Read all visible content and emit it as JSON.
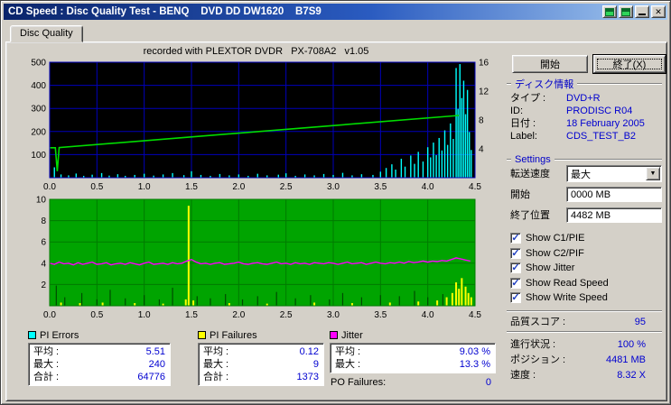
{
  "window": {
    "title": "CD Speed : Disc Quality Test - BENQ    DVD DD DW1620    B7S9"
  },
  "icons": {
    "minimize": "",
    "close": "✕",
    "combo_arrow": "▼",
    "check": "✓"
  },
  "tab": {
    "label": "Disc Quality"
  },
  "chart_header": "recorded with PLEXTOR DVDR   PX-708A2   v1.05",
  "buttons": {
    "start": "開始",
    "exit": "終了(X)"
  },
  "disc_info": {
    "title": "ディスク情報",
    "rows": [
      {
        "label": "タイプ :",
        "value": "DVD+R"
      },
      {
        "label": "ID:",
        "value": "PRODISC R04"
      },
      {
        "label": "日付 :",
        "value": "18 February 2005"
      },
      {
        "label": "Label:",
        "value": "CDS_TEST_B2"
      }
    ]
  },
  "settings": {
    "title": "Settings",
    "speed_label": "転送速度",
    "speed_value": "最大",
    "start_label": "開始",
    "start_value": "0000 MB",
    "end_label": "終了位置",
    "end_value": "4482 MB",
    "checkboxes": [
      {
        "label": "Show C1/PIE",
        "checked": true
      },
      {
        "label": "Show C2/PIF",
        "checked": true
      },
      {
        "label": "Show Jitter",
        "checked": true
      },
      {
        "label": "Show Read Speed",
        "checked": true
      },
      {
        "label": "Show Write Speed",
        "checked": true
      }
    ]
  },
  "quality": {
    "label": "品質スコア :",
    "value": "95"
  },
  "progress": [
    {
      "label": "進行状況 :",
      "value": "100 %"
    },
    {
      "label": "ポジション :",
      "value": "4481 MB"
    },
    {
      "label": "速度 :",
      "value": "8.32 X"
    }
  ],
  "legends": [
    {
      "name": "PI Errors",
      "color": "#00FFFF",
      "rows": [
        [
          "平均 :",
          "5.51"
        ],
        [
          "最大 :",
          "240"
        ],
        [
          "合計 :",
          "64776"
        ]
      ]
    },
    {
      "name": "PI Failures",
      "color": "#FFFF00",
      "rows": [
        [
          "平均 :",
          "0.12"
        ],
        [
          "最大 :",
          "9"
        ],
        [
          "合計 :",
          "1373"
        ]
      ]
    },
    {
      "name": "Jitter",
      "color": "#FF00FF",
      "rows": [
        [
          "平均 :",
          "9.03 %"
        ],
        [
          "最大 :",
          "13.3 %"
        ]
      ],
      "extra": {
        "label": "PO Failures:",
        "value": "0"
      }
    }
  ],
  "chart_data": [
    {
      "type": "line",
      "title": "PI Errors / Speed",
      "bg": "#000000",
      "grid": "#0000BB",
      "x": {
        "min": 0,
        "max": 4.5,
        "ticks": [
          0,
          0.5,
          1,
          1.5,
          2,
          2.5,
          3,
          3.5,
          4,
          4.5
        ],
        "labels": [
          "0.0",
          "0.5",
          "1.0",
          "1.5",
          "2.0",
          "2.5",
          "3.0",
          "3.5",
          "4.0",
          "4.5"
        ]
      },
      "y_left": {
        "min": 0,
        "max": 500,
        "ticks": [
          100,
          200,
          300,
          400,
          500
        ]
      },
      "y_right": {
        "min": 0,
        "max": 16,
        "ticks": [
          4,
          8,
          12,
          16
        ]
      },
      "series": [
        {
          "name": "PI Errors",
          "type": "spikes",
          "axis": "left",
          "color": "#00FFFF",
          "w": 1.4,
          "points": [
            [
              0.05,
              45
            ],
            [
              0.12,
              14
            ],
            [
              0.2,
              10
            ],
            [
              0.28,
              18
            ],
            [
              0.36,
              8
            ],
            [
              0.45,
              13
            ],
            [
              0.55,
              20
            ],
            [
              0.63,
              9
            ],
            [
              0.72,
              15
            ],
            [
              0.8,
              8
            ],
            [
              0.9,
              12
            ],
            [
              1.0,
              17
            ],
            [
              1.1,
              9
            ],
            [
              1.2,
              14
            ],
            [
              1.3,
              20
            ],
            [
              1.42,
              11
            ],
            [
              1.5,
              28
            ],
            [
              1.6,
              12
            ],
            [
              1.7,
              8
            ],
            [
              1.8,
              16
            ],
            [
              1.9,
              10
            ],
            [
              2.0,
              14
            ],
            [
              2.1,
              8
            ],
            [
              2.2,
              17
            ],
            [
              2.3,
              10
            ],
            [
              2.42,
              13
            ],
            [
              2.5,
              19
            ],
            [
              2.6,
              8
            ],
            [
              2.7,
              14
            ],
            [
              2.8,
              10
            ],
            [
              2.9,
              16
            ],
            [
              3.0,
              12
            ],
            [
              3.1,
              21
            ],
            [
              3.2,
              10
            ],
            [
              3.3,
              15
            ],
            [
              3.42,
              12
            ],
            [
              3.5,
              26
            ],
            [
              3.56,
              42
            ],
            [
              3.62,
              58
            ],
            [
              3.66,
              35
            ],
            [
              3.72,
              82
            ],
            [
              3.76,
              48
            ],
            [
              3.82,
              96
            ],
            [
              3.86,
              60
            ],
            [
              3.9,
              112
            ],
            [
              3.95,
              70
            ],
            [
              4.0,
              132
            ],
            [
              4.03,
              88
            ],
            [
              4.06,
              152
            ],
            [
              4.09,
              98
            ],
            [
              4.12,
              172
            ],
            [
              4.15,
              118
            ],
            [
              4.18,
              205
            ],
            [
              4.21,
              142
            ],
            [
              4.24,
              235
            ],
            [
              4.27,
              168
            ],
            [
              4.3,
              475
            ],
            [
              4.32,
              298
            ],
            [
              4.34,
              492
            ],
            [
              4.36,
              345
            ],
            [
              4.38,
              420
            ],
            [
              4.4,
              275
            ],
            [
              4.42,
              380
            ],
            [
              4.44,
              198
            ],
            [
              4.46,
              120
            ]
          ]
        },
        {
          "name": "Write Speed",
          "type": "line",
          "axis": "right",
          "color": "#00DD00",
          "w": 1.6,
          "points": [
            [
              0,
              4.15
            ],
            [
              0.06,
              4.15
            ],
            [
              0.08,
              0.9
            ],
            [
              0.1,
              4.18
            ],
            [
              4.33,
              8.62
            ]
          ]
        }
      ]
    },
    {
      "type": "line",
      "title": "PI Failures / Jitter",
      "bg": "#00A400",
      "grid": "#007A00",
      "x": {
        "min": 0,
        "max": 4.5,
        "ticks": [
          0,
          0.5,
          1,
          1.5,
          2,
          2.5,
          3,
          3.5,
          4,
          4.5
        ],
        "labels": [
          "0.0",
          "0.5",
          "1.0",
          "1.5",
          "2.0",
          "2.5",
          "3.0",
          "3.5",
          "4.0",
          "4.5"
        ]
      },
      "y_left": {
        "min": 0,
        "max": 10,
        "ticks": [
          2,
          4,
          6,
          8,
          10
        ]
      },
      "series": [
        {
          "name": "noise",
          "type": "spikes",
          "axis": "left",
          "color": "#004A00",
          "w": 1.2,
          "points": [
            [
              0.07,
              1.9
            ],
            [
              0.16,
              0.8
            ],
            [
              0.34,
              1.2
            ],
            [
              0.5,
              0.6
            ],
            [
              0.64,
              1.5
            ],
            [
              0.8,
              0.7
            ],
            [
              1.0,
              1.0
            ],
            [
              1.16,
              0.6
            ],
            [
              1.3,
              1.7
            ],
            [
              1.56,
              0.9
            ],
            [
              1.7,
              0.7
            ],
            [
              1.86,
              1.1
            ],
            [
              2.04,
              0.6
            ],
            [
              2.2,
              0.9
            ],
            [
              2.4,
              1.3
            ],
            [
              2.6,
              0.7
            ],
            [
              2.76,
              1.0
            ],
            [
              2.96,
              0.6
            ],
            [
              3.1,
              1.2
            ],
            [
              3.3,
              0.8
            ],
            [
              3.5,
              1.0
            ],
            [
              3.7,
              0.9
            ],
            [
              3.86,
              1.4
            ],
            [
              4.0,
              0.8
            ],
            [
              4.16,
              1.1
            ]
          ]
        },
        {
          "name": "PI Failures",
          "type": "spikes",
          "axis": "left",
          "color": "#FFFF00",
          "w": 2,
          "points": [
            [
              0.12,
              0.3
            ],
            [
              0.32,
              0.25
            ],
            [
              0.56,
              0.3
            ],
            [
              0.9,
              0.25
            ],
            [
              1.2,
              0.2
            ],
            [
              1.44,
              0.6
            ],
            [
              1.47,
              9.4
            ],
            [
              1.52,
              0.5
            ],
            [
              1.9,
              0.25
            ],
            [
              2.3,
              0.2
            ],
            [
              2.8,
              0.3
            ],
            [
              3.2,
              0.25
            ],
            [
              3.6,
              0.3
            ],
            [
              3.9,
              0.4
            ],
            [
              4.1,
              0.5
            ],
            [
              4.2,
              0.8
            ],
            [
              4.26,
              1.2
            ],
            [
              4.3,
              2.2
            ],
            [
              4.33,
              1.6
            ],
            [
              4.36,
              2.6
            ],
            [
              4.4,
              1.8
            ],
            [
              4.43,
              1.2
            ],
            [
              4.46,
              0.8
            ]
          ]
        },
        {
          "name": "Jitter",
          "type": "line",
          "axis": "left",
          "color": "#FF00FF",
          "w": 1.4,
          "points": {
            "x0": 0,
            "dx": 0.05,
            "values": [
              4.0,
              3.9,
              4.1,
              3.95,
              4.0,
              3.85,
              4.05,
              3.9,
              4.0,
              4.1,
              3.9,
              3.95,
              4.05,
              3.85,
              3.95,
              4.0,
              3.9,
              4.05,
              3.95,
              3.85,
              4.0,
              4.1,
              3.9,
              3.95,
              4.0,
              3.9,
              4.05,
              3.95,
              4.0,
              4.2,
              4.35,
              4.1,
              3.95,
              4.0,
              3.9,
              4.0,
              4.05,
              3.9,
              3.95,
              4.0,
              4.1,
              3.95,
              3.9,
              4.0,
              4.05,
              3.95,
              3.9,
              4.0,
              4.1,
              3.95,
              4.0,
              3.9,
              4.05,
              3.95,
              4.0,
              3.9,
              4.05,
              4.0,
              3.95,
              4.05,
              4.0,
              3.9,
              4.0,
              4.1,
              3.95,
              4.0,
              4.05,
              3.9,
              4.0,
              4.1,
              4.0,
              3.95,
              4.05,
              4.0,
              4.1,
              4.0,
              4.15,
              4.05,
              4.1,
              4.2,
              4.1,
              4.2,
              4.15,
              4.25,
              4.2,
              4.35,
              4.5,
              4.4,
              4.3,
              4.2
            ]
          }
        }
      ]
    }
  ]
}
